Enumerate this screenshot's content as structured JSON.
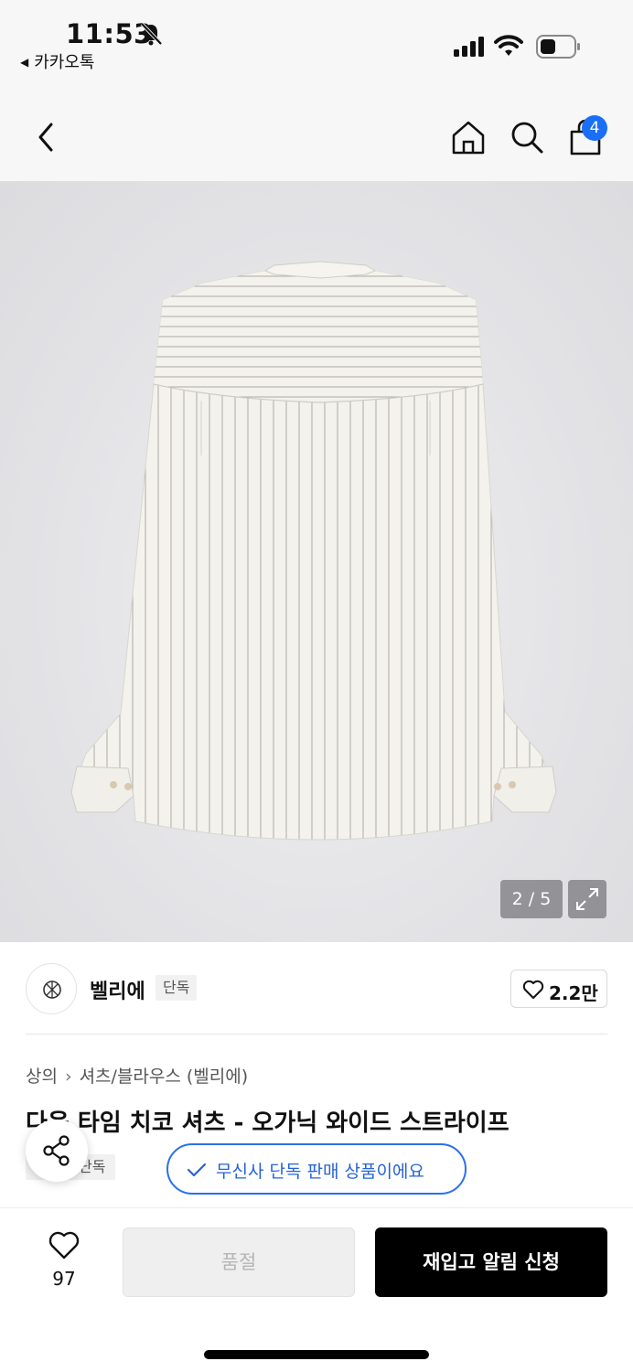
{
  "status_bar": {
    "time": "11:53",
    "back_app": "카카오톡",
    "icons": [
      "bell-muted-icon",
      "signal-icon",
      "wifi-icon",
      "battery-icon"
    ]
  },
  "nav": {
    "icons": [
      "back-icon",
      "home-icon",
      "search-icon",
      "cart-icon"
    ],
    "cart_badge": "4"
  },
  "gallery": {
    "counter": "2 / 5",
    "icons": [
      "expand-icon"
    ]
  },
  "brand": {
    "name": "벨리에",
    "tag": "단독",
    "like_count": "2.2만"
  },
  "product": {
    "breadcrumb": [
      "상의",
      "셔츠/블라우스 (벨리에)"
    ],
    "title": "다음 타임 치코 셔츠 - 오가닉 와이드 스트라이프",
    "tag": "단독",
    "exclusive_notice": "무신사 단독 판매 상품이에요"
  },
  "bottom": {
    "wish_count": "97",
    "soldout_label": "품절",
    "restock_label": "재입고 알림 신청"
  },
  "colors": {
    "accent_blue": "#1a6ff5",
    "primary_button": "#000000",
    "disabled_button": "#efefef"
  }
}
